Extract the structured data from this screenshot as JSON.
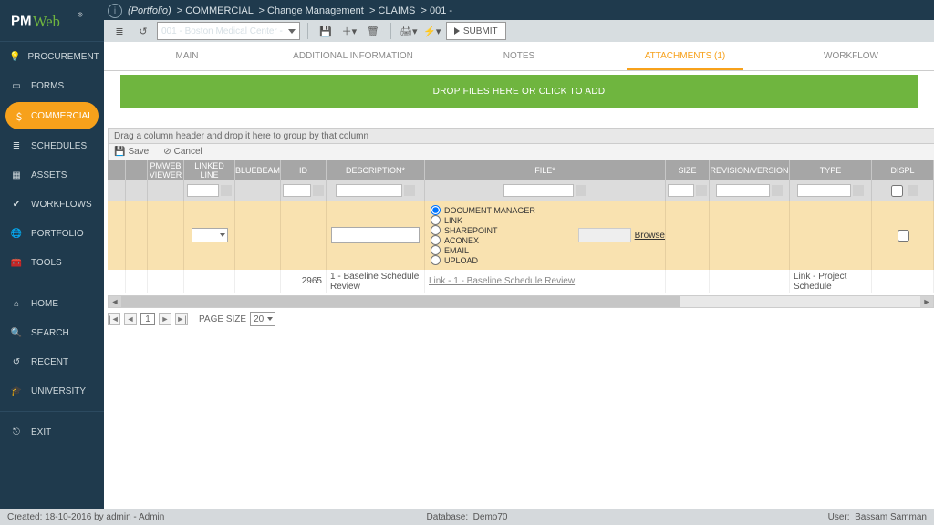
{
  "app": {
    "name": "PMWeb"
  },
  "breadcrumb": {
    "portfolio": "(Portfolio)",
    "l1": "COMMERCIAL",
    "l2": "Change Management",
    "l3": "CLAIMS",
    "l4": "001 -"
  },
  "toolbar": {
    "project_select": "001 - Boston Medical Center -",
    "submit": "SUBMIT"
  },
  "sidebar": {
    "items": [
      {
        "label": "PROCUREMENT",
        "icon": "bulb"
      },
      {
        "label": "FORMS",
        "icon": "form"
      },
      {
        "label": "COMMERCIAL",
        "icon": "dollar",
        "active": true
      },
      {
        "label": "SCHEDULES",
        "icon": "list"
      },
      {
        "label": "ASSETS",
        "icon": "asset"
      },
      {
        "label": "WORKFLOWS",
        "icon": "check"
      },
      {
        "label": "PORTFOLIO",
        "icon": "globe"
      },
      {
        "label": "TOOLS",
        "icon": "toolbox"
      }
    ],
    "items2": [
      {
        "label": "HOME",
        "icon": "home"
      },
      {
        "label": "SEARCH",
        "icon": "search"
      },
      {
        "label": "RECENT",
        "icon": "recent"
      },
      {
        "label": "UNIVERSITY",
        "icon": "grad"
      }
    ],
    "exit": {
      "label": "EXIT"
    }
  },
  "tabs": [
    {
      "label": "MAIN"
    },
    {
      "label": "ADDITIONAL INFORMATION"
    },
    {
      "label": "NOTES"
    },
    {
      "label": "ATTACHMENTS (1)",
      "active": true
    },
    {
      "label": "WORKFLOW"
    }
  ],
  "dropzone": "DROP FILES HERE OR CLICK TO ADD",
  "grouphdr": "Drag a column header and drop it here to group by that column",
  "rowactions": {
    "save": "Save",
    "cancel": "Cancel"
  },
  "columns": {
    "pm": "PMWEB VIEWER",
    "line": "LINKED LINE",
    "bb": "BLUEBEAM",
    "id": "ID",
    "desc": "DESCRIPTION*",
    "file": "FILE*",
    "size": "SIZE",
    "rev": "REVISION/VERSION",
    "type": "TYPE",
    "disp": "DISPL"
  },
  "file_options": [
    "DOCUMENT MANAGER",
    "LINK",
    "SHAREPOINT",
    "ACONEX",
    "EMAIL",
    "UPLOAD"
  ],
  "file_selected": "DOCUMENT MANAGER",
  "browse": "Browse",
  "row1": {
    "id": "2965",
    "desc": "1 - Baseline Schedule Review",
    "file": "Link - 1 - Baseline Schedule Review",
    "type": "Link - Project Schedule"
  },
  "pager": {
    "page": "1",
    "size_label": "PAGE SIZE",
    "size": "20"
  },
  "footer": {
    "created": "Created:   18-10-2016 by admin - Admin",
    "db_label": "Database:",
    "db": "Demo70",
    "user_label": "User:",
    "user": "Bassam Samman"
  }
}
